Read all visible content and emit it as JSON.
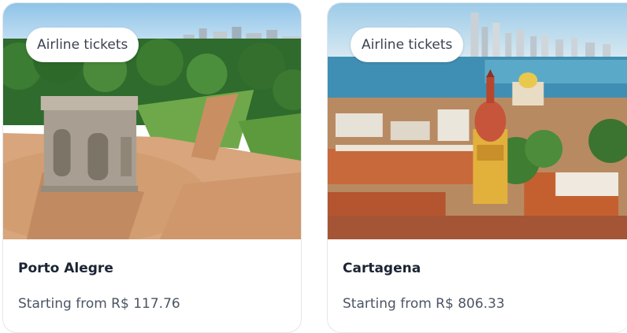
{
  "cards": [
    {
      "badge": "Airline tickets",
      "city": "Porto Alegre",
      "price": "Starting from R$ 117.76"
    },
    {
      "badge": "Airline tickets",
      "city": "Cartagena",
      "price": "Starting from R$ 806.33"
    }
  ]
}
